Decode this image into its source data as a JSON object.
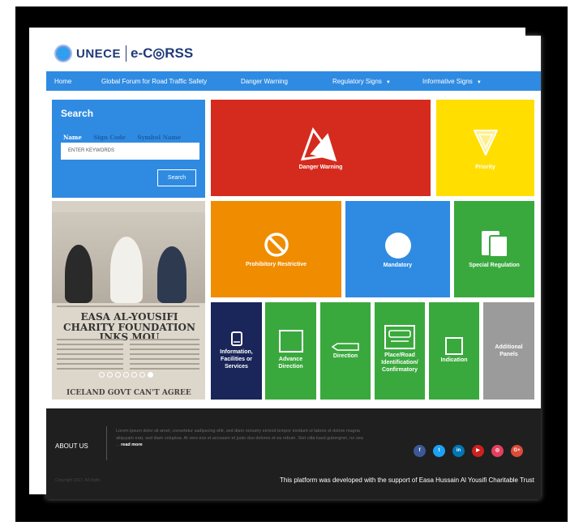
{
  "header": {
    "brand_unece": "UNECE",
    "brand_product": "e-C◎RSS"
  },
  "nav": {
    "items": [
      {
        "label": "Home",
        "has_caret": false
      },
      {
        "label": "Global Forum for Road Traffic Safety",
        "has_caret": false
      },
      {
        "label": "Danger Warning",
        "has_caret": false
      },
      {
        "label": "Regulatory Signs",
        "has_caret": true
      },
      {
        "label": "Informative Signs",
        "has_caret": true
      }
    ]
  },
  "search": {
    "title": "Search",
    "tabs": [
      "Name",
      "Sign Code",
      "Symbol Name"
    ],
    "active_tab": "Name",
    "input_placeholder": "ENTER KEYWORDS",
    "input_value": "",
    "button_label": "Search"
  },
  "tiles": {
    "danger": "Danger Warning",
    "priority": "Priority",
    "prohibitory": "Prohibitory Restrictive",
    "mandatory": "Mandatory",
    "special": "Special Regulation",
    "information": "Information, Facilities or Services",
    "advance_direction": "Advance Direction",
    "direction": "Direction",
    "place": "Place/Road Identification/ Confirmatory",
    "indication": "Indication",
    "additional": "Additional Panels"
  },
  "slideshow": {
    "headline": "EASA AL-YOUSIFI CHARITY FOUNDATION INKS MOU",
    "bottom_headline": "ICELAND GOVT CAN'T AGREE",
    "slide_count": 7,
    "active_slide": 7
  },
  "footer": {
    "about_label": "ABOUT US",
    "about_text": "Lorem ipsum dolor sit amet, consetetur sadipscing elitr, sed diam nonumy eirmod tempor invidunt ut labore et dolore magna aliquyam erat, sed diam voluptua. At vero eos et accusam et justo duo dolores et ea rebum. Stet clita kasd gubergren, no sea ...",
    "read_more": "read more",
    "social": [
      {
        "icon": "facebook-icon",
        "glyph": "f",
        "color": "#3b5998"
      },
      {
        "icon": "twitter-icon",
        "glyph": "t",
        "color": "#1da1f2"
      },
      {
        "icon": "linkedin-icon",
        "glyph": "in",
        "color": "#0077b5"
      },
      {
        "icon": "youtube-icon",
        "glyph": "▶",
        "color": "#cd201f"
      },
      {
        "icon": "instagram-icon",
        "glyph": "◎",
        "color": "#e4405f"
      },
      {
        "icon": "google-plus-icon",
        "glyph": "G+",
        "color": "#dd4b39"
      }
    ],
    "copyright": "Copyright 2017. All Right",
    "credit": "This platform was developed with the support of Easa Hussain Al Yousifi Charitable Trust"
  },
  "colors": {
    "nav_blue": "#2f8be2",
    "danger_red": "#d52b1e",
    "priority_yellow": "#ffde00",
    "prohibitory_orange": "#f08c00",
    "regulation_green": "#3aa93d",
    "info_navy": "#1a2559",
    "additional_grey": "#9b9b9b",
    "footer_dark": "#1f1f1f"
  }
}
